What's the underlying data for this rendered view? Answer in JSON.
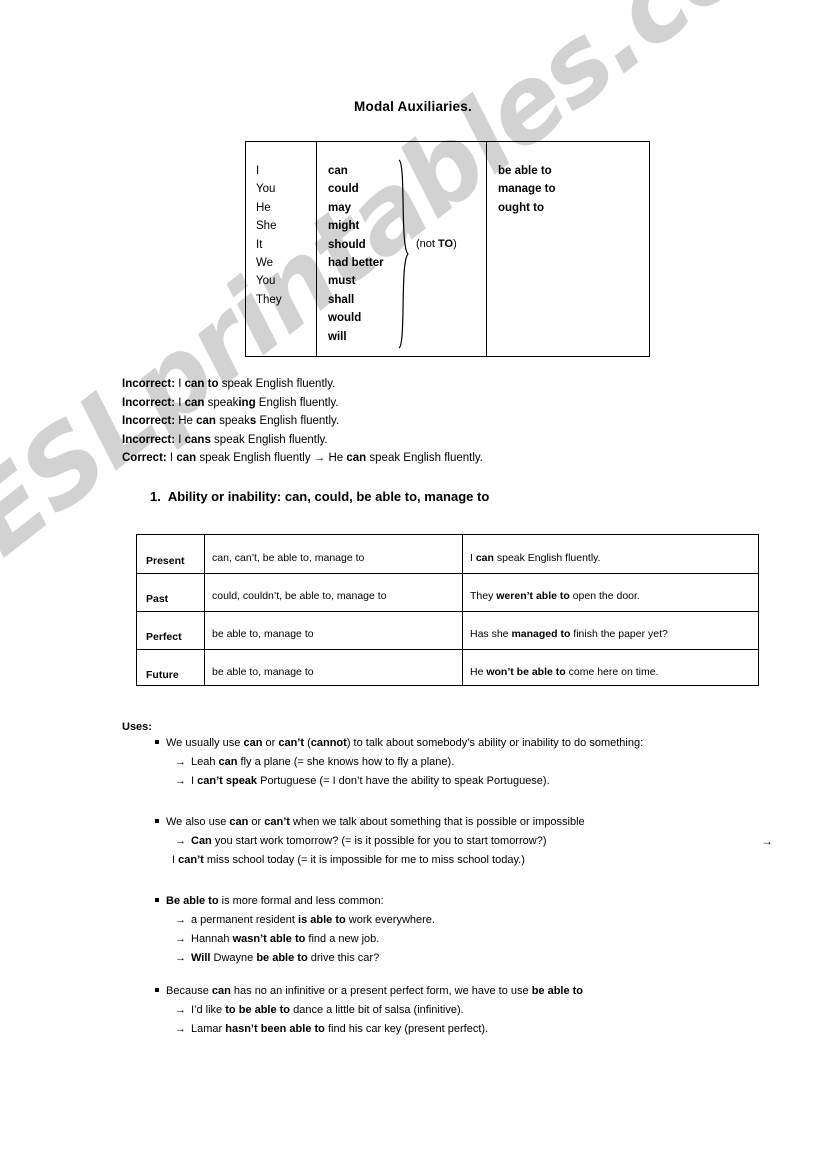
{
  "document": {
    "title": "Modal Auxiliaries.",
    "watermark": "ESLprintables.com"
  },
  "modal_table": {
    "pronouns": [
      "I",
      "You",
      "He",
      "She",
      "It",
      "We",
      "You",
      "They"
    ],
    "modals": [
      "can",
      "could",
      "may",
      "might",
      "should",
      "had better",
      "must",
      "shall",
      "would",
      "will"
    ],
    "brace_note_prefix": "(not ",
    "brace_note_bold": "TO",
    "brace_note_suffix": ")",
    "phrases": [
      "be able to",
      "manage to",
      "ought to"
    ]
  },
  "examples": [
    {
      "label": "Incorrect:",
      "parts": [
        {
          "t": " I ",
          "b": false
        },
        {
          "t": "can to",
          "b": true
        },
        {
          "t": " speak English fluently.",
          "b": false
        }
      ]
    },
    {
      "label": "Incorrect:",
      "parts": [
        {
          "t": " I ",
          "b": false
        },
        {
          "t": "can",
          "b": true
        },
        {
          "t": " speak",
          "b": false
        },
        {
          "t": "ing",
          "b": true
        },
        {
          "t": " English fluently.",
          "b": false
        }
      ]
    },
    {
      "label": "Incorrect:",
      "parts": [
        {
          "t": " He ",
          "b": false
        },
        {
          "t": "can",
          "b": true
        },
        {
          "t": " speak",
          "b": false
        },
        {
          "t": "s",
          "b": true
        },
        {
          "t": " English fluently.",
          "b": false
        }
      ]
    },
    {
      "label": "Incorrect:",
      "parts": [
        {
          "t": " I ",
          "b": false
        },
        {
          "t": "cans",
          "b": true
        },
        {
          "t": " speak English fluently.",
          "b": false
        }
      ]
    },
    {
      "label": "Correct:",
      "parts": [
        {
          "t": " I ",
          "b": false
        },
        {
          "t": "can",
          "b": true
        },
        {
          "t": " speak English fluently  → He ",
          "b": false
        },
        {
          "t": "can",
          "b": true
        },
        {
          "t": " speak English fluently.",
          "b": false
        }
      ]
    }
  ],
  "section": {
    "number": "1.",
    "heading": "Ability or inability: can, could, be able to, manage to"
  },
  "tense_table": {
    "rows": [
      {
        "tense": "Present",
        "forms": "can, can’t, be able to, manage to",
        "example": [
          {
            "t": "I ",
            "b": false
          },
          {
            "t": "can",
            "b": true
          },
          {
            "t": " speak English fluently.",
            "b": false
          }
        ]
      },
      {
        "tense": "Past",
        "forms": "could, couldn’t, be able to, manage to",
        "example": [
          {
            "t": "They ",
            "b": false
          },
          {
            "t": "weren’t able to",
            "b": true
          },
          {
            "t": " open the door.",
            "b": false
          }
        ]
      },
      {
        "tense": "Perfect",
        "forms": "be able to, manage to",
        "example": [
          {
            "t": "Has she ",
            "b": false
          },
          {
            "t": "managed to",
            "b": true
          },
          {
            "t": " finish the paper yet?",
            "b": false
          }
        ]
      },
      {
        "tense": "Future",
        "forms": "be able to, manage to",
        "example": [
          {
            "t": "He ",
            "b": false
          },
          {
            "t": "won’t be able to",
            "b": true
          },
          {
            "t": " come here on time.",
            "b": false
          }
        ]
      }
    ]
  },
  "uses": {
    "label": "Uses:",
    "groups": [
      {
        "bullet": [
          {
            "t": "We usually use ",
            "b": false
          },
          {
            "t": "can",
            "b": true
          },
          {
            "t": " or ",
            "b": false
          },
          {
            "t": "can’t",
            "b": true
          },
          {
            "t": " (",
            "b": false
          },
          {
            "t": "cannot",
            "b": true
          },
          {
            "t": ") to talk about somebody’s ability or inability to do something:",
            "b": false
          }
        ],
        "lines": [
          {
            "arrow": true,
            "parts": [
              {
                "t": "Leah ",
                "b": false
              },
              {
                "t": "can",
                "b": true
              },
              {
                "t": " fly a plane (= she knows how to fly a plane).",
                "b": false
              }
            ]
          },
          {
            "arrow": true,
            "parts": [
              {
                "t": "I ",
                "b": false
              },
              {
                "t": "can’t speak",
                "b": true
              },
              {
                "t": " Portuguese (= I don’t have the ability to speak Portuguese).",
                "b": false
              }
            ]
          }
        ]
      },
      {
        "bullet": [
          {
            "t": "We also use ",
            "b": false
          },
          {
            "t": "can",
            "b": true
          },
          {
            "t": " or ",
            "b": false
          },
          {
            "t": "can’t",
            "b": true
          },
          {
            "t": " when we talk about something that is possible or impossible",
            "b": false
          }
        ],
        "lines": [
          {
            "arrow": true,
            "parts": [
              {
                "t": "Can",
                "b": true
              },
              {
                "t": " you start work tomorrow? (= is it possible for you to start tomorrow?)",
                "b": false
              }
            ]
          },
          {
            "arrow": false,
            "parts": [
              {
                "t": "I ",
                "b": false
              },
              {
                "t": "can’t",
                "b": true
              },
              {
                "t": " miss school today (= it is impossible for me to miss school today.)",
                "b": false
              }
            ]
          }
        ]
      },
      {
        "bullet": [
          {
            "t": "Be able to",
            "b": true
          },
          {
            "t": " is more formal and less common:",
            "b": false
          }
        ],
        "lines": [
          {
            "arrow": true,
            "parts": [
              {
                "t": "a permanent resident ",
                "b": false
              },
              {
                "t": "is able to",
                "b": true
              },
              {
                "t": " work everywhere.",
                "b": false
              }
            ]
          },
          {
            "arrow": true,
            "parts": [
              {
                "t": "Hannah ",
                "b": false
              },
              {
                "t": "wasn’t able to",
                "b": true
              },
              {
                "t": " find a new job.",
                "b": false
              }
            ]
          },
          {
            "arrow": true,
            "parts": [
              {
                "t": "Will",
                "b": true
              },
              {
                "t": " Dwayne ",
                "b": false
              },
              {
                "t": "be able to",
                "b": true
              },
              {
                "t": " drive this car?",
                "b": false
              }
            ]
          }
        ]
      },
      {
        "bullet": [
          {
            "t": "Because ",
            "b": false
          },
          {
            "t": "can",
            "b": true
          },
          {
            "t": " has no an infinitive or a present perfect form,  we have to use ",
            "b": false
          },
          {
            "t": "be able to",
            "b": true
          }
        ],
        "lines": [
          {
            "arrow": true,
            "parts": [
              {
                "t": "I’d like ",
                "b": false
              },
              {
                "t": "to be able to",
                "b": true
              },
              {
                "t": " dance a little bit of salsa (infinitive).",
                "b": false
              }
            ]
          },
          {
            "arrow": true,
            "parts": [
              {
                "t": "Lamar ",
                "b": false
              },
              {
                "t": "hasn’t been able to",
                "b": true
              },
              {
                "t": " find his car key (present perfect).",
                "b": false
              }
            ]
          }
        ]
      }
    ],
    "stray_arrow": "→"
  },
  "glyphs": {
    "arrow": "→",
    "bullet_square": "▪"
  }
}
